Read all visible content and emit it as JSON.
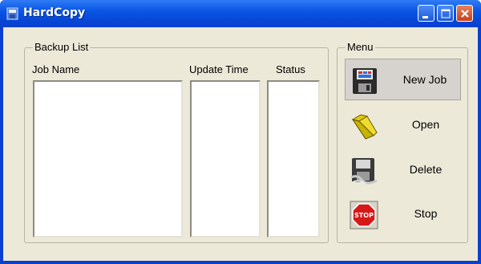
{
  "window": {
    "title": "HardCopy"
  },
  "backup_list": {
    "title": "Backup List",
    "columns": [
      "Job Name",
      "Update Time",
      "Status"
    ]
  },
  "menu": {
    "title": "Menu",
    "items": [
      {
        "label": "New Job",
        "icon": "floppy-disk-icon"
      },
      {
        "label": "Open",
        "icon": "folder-icon"
      },
      {
        "label": "Delete",
        "icon": "delete-disk-icon"
      },
      {
        "label": "Stop",
        "icon": "stop-sign-icon"
      }
    ]
  },
  "colors": {
    "titlebar": "#0a56e6",
    "window_bg": "#ece9d8",
    "close_button": "#c8401b"
  }
}
